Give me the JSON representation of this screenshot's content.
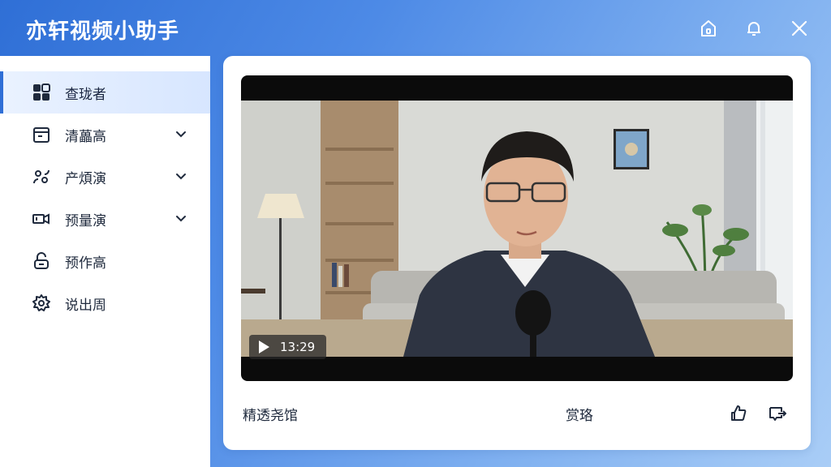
{
  "app": {
    "title": "亦轩视频小助手"
  },
  "titlebar": {
    "icons": [
      "home-icon",
      "bell-icon",
      "close-icon"
    ]
  },
  "sidebar": {
    "items": [
      {
        "label": "查珑者",
        "icon": "dashboard-icon",
        "active": true,
        "expandable": false
      },
      {
        "label": "清藟高",
        "icon": "calendar-icon",
        "active": false,
        "expandable": true
      },
      {
        "label": "产煩演",
        "icon": "users-icon",
        "active": false,
        "expandable": true
      },
      {
        "label": "预量演",
        "icon": "video-icon",
        "active": false,
        "expandable": true
      },
      {
        "label": "预作高",
        "icon": "lock-icon",
        "active": false,
        "expandable": false
      },
      {
        "label": "说出周",
        "icon": "gear-icon",
        "active": false,
        "expandable": false
      }
    ]
  },
  "player": {
    "time": "13:29",
    "play_icon": "play-icon"
  },
  "footer": {
    "left_text": "精透尧馆",
    "center_text": "赏珞",
    "icons": [
      "share-icon",
      "comment-icon"
    ]
  },
  "colors": {
    "accent": "#2f6fd6",
    "sidebar_active_bg": "#d7e6ff",
    "text": "#1f2a3d"
  }
}
